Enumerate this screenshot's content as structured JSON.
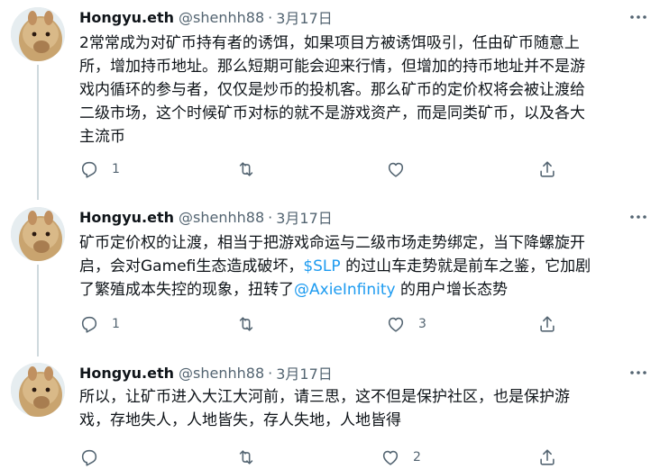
{
  "tweets": [
    {
      "name": "Hongyu.eth",
      "handle": "@shenhh88",
      "separator": "·",
      "date": "3月17日",
      "text_lines": [
        "2常常成为对矿币持有者的诱饵，如果项目方被诱饵吸引，任由矿币随意上",
        "所，增加持币地址。那么短期可能会迎来行情，但增加的持币地址并不是游",
        "戏内循环的参与者，仅仅是炒币的投机客。那么矿币的定价权将会被让渡给",
        "二级市场，这个时候矿币对标的就不是游戏资产，而是同类矿币，以及各大",
        "主流币"
      ],
      "reply_count": "1",
      "retweet_count": "",
      "like_count": ""
    },
    {
      "name": "Hongyu.eth",
      "handle": "@shenhh88",
      "separator": "·",
      "date": "3月17日",
      "text_line1": "矿币定价权的让渡，相当于把游戏命运与二级市场走势绑定，当下降螺旋开",
      "text_line2_a": "启，会对Gamefi生态造成破坏，",
      "text_line2_link": "$SLP",
      "text_line2_b": " 的过山车走势就是前车之鉴，它加剧",
      "text_line3_a": "了繁殖成本失控的现象，扭转了",
      "text_line3_link": "@AxieInfinity",
      "text_line3_b": " 的用户增长态势",
      "reply_count": "1",
      "retweet_count": "",
      "like_count": "3"
    },
    {
      "name": "Hongyu.eth",
      "handle": "@shenhh88",
      "separator": "·",
      "date": "3月17日",
      "text_lines": [
        "所以，让矿币进入大江大河前，请三思，这不但是保护社区，也是保护游",
        "戏，存地失人，人地皆失，存人失地，人地皆得"
      ],
      "reply_count": "",
      "retweet_count": "",
      "like_count": "2"
    }
  ],
  "icons": {
    "reply": "reply-icon",
    "retweet": "retweet-icon",
    "like": "heart-icon",
    "share": "share-icon",
    "more": "more-icon",
    "avatar": "alpaca-avatar"
  },
  "colors": {
    "text": "#0f1419",
    "secondary": "#536471",
    "link": "#1d9bf0",
    "thread_line": "#cfd9de"
  }
}
